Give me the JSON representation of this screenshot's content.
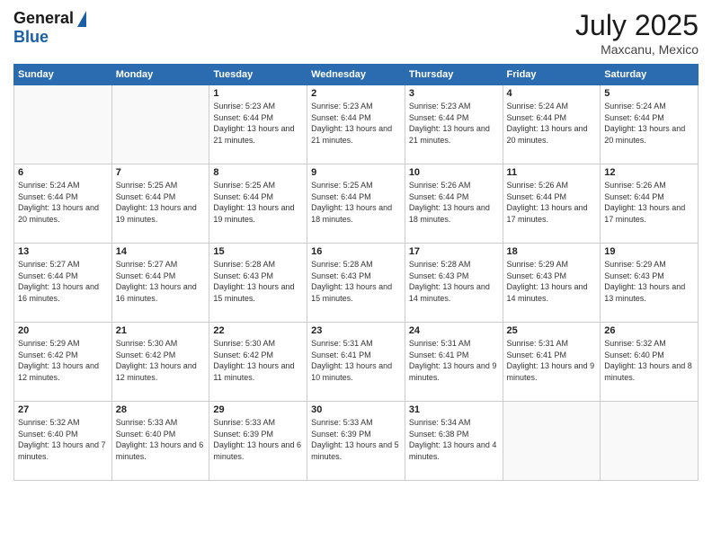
{
  "logo": {
    "general": "General",
    "blue": "Blue"
  },
  "header": {
    "month_year": "July 2025",
    "location": "Maxcanu, Mexico"
  },
  "days_of_week": [
    "Sunday",
    "Monday",
    "Tuesday",
    "Wednesday",
    "Thursday",
    "Friday",
    "Saturday"
  ],
  "weeks": [
    [
      {
        "day": "",
        "empty": true
      },
      {
        "day": "",
        "empty": true
      },
      {
        "day": "1",
        "sunrise": "5:23 AM",
        "sunset": "6:44 PM",
        "daylight": "13 hours and 21 minutes."
      },
      {
        "day": "2",
        "sunrise": "5:23 AM",
        "sunset": "6:44 PM",
        "daylight": "13 hours and 21 minutes."
      },
      {
        "day": "3",
        "sunrise": "5:23 AM",
        "sunset": "6:44 PM",
        "daylight": "13 hours and 21 minutes."
      },
      {
        "day": "4",
        "sunrise": "5:24 AM",
        "sunset": "6:44 PM",
        "daylight": "13 hours and 20 minutes."
      },
      {
        "day": "5",
        "sunrise": "5:24 AM",
        "sunset": "6:44 PM",
        "daylight": "13 hours and 20 minutes."
      }
    ],
    [
      {
        "day": "6",
        "sunrise": "5:24 AM",
        "sunset": "6:44 PM",
        "daylight": "13 hours and 20 minutes."
      },
      {
        "day": "7",
        "sunrise": "5:25 AM",
        "sunset": "6:44 PM",
        "daylight": "13 hours and 19 minutes."
      },
      {
        "day": "8",
        "sunrise": "5:25 AM",
        "sunset": "6:44 PM",
        "daylight": "13 hours and 19 minutes."
      },
      {
        "day": "9",
        "sunrise": "5:25 AM",
        "sunset": "6:44 PM",
        "daylight": "13 hours and 18 minutes."
      },
      {
        "day": "10",
        "sunrise": "5:26 AM",
        "sunset": "6:44 PM",
        "daylight": "13 hours and 18 minutes."
      },
      {
        "day": "11",
        "sunrise": "5:26 AM",
        "sunset": "6:44 PM",
        "daylight": "13 hours and 17 minutes."
      },
      {
        "day": "12",
        "sunrise": "5:26 AM",
        "sunset": "6:44 PM",
        "daylight": "13 hours and 17 minutes."
      }
    ],
    [
      {
        "day": "13",
        "sunrise": "5:27 AM",
        "sunset": "6:44 PM",
        "daylight": "13 hours and 16 minutes."
      },
      {
        "day": "14",
        "sunrise": "5:27 AM",
        "sunset": "6:44 PM",
        "daylight": "13 hours and 16 minutes."
      },
      {
        "day": "15",
        "sunrise": "5:28 AM",
        "sunset": "6:43 PM",
        "daylight": "13 hours and 15 minutes."
      },
      {
        "day": "16",
        "sunrise": "5:28 AM",
        "sunset": "6:43 PM",
        "daylight": "13 hours and 15 minutes."
      },
      {
        "day": "17",
        "sunrise": "5:28 AM",
        "sunset": "6:43 PM",
        "daylight": "13 hours and 14 minutes."
      },
      {
        "day": "18",
        "sunrise": "5:29 AM",
        "sunset": "6:43 PM",
        "daylight": "13 hours and 14 minutes."
      },
      {
        "day": "19",
        "sunrise": "5:29 AM",
        "sunset": "6:43 PM",
        "daylight": "13 hours and 13 minutes."
      }
    ],
    [
      {
        "day": "20",
        "sunrise": "5:29 AM",
        "sunset": "6:42 PM",
        "daylight": "13 hours and 12 minutes."
      },
      {
        "day": "21",
        "sunrise": "5:30 AM",
        "sunset": "6:42 PM",
        "daylight": "13 hours and 12 minutes."
      },
      {
        "day": "22",
        "sunrise": "5:30 AM",
        "sunset": "6:42 PM",
        "daylight": "13 hours and 11 minutes."
      },
      {
        "day": "23",
        "sunrise": "5:31 AM",
        "sunset": "6:41 PM",
        "daylight": "13 hours and 10 minutes."
      },
      {
        "day": "24",
        "sunrise": "5:31 AM",
        "sunset": "6:41 PM",
        "daylight": "13 hours and 9 minutes."
      },
      {
        "day": "25",
        "sunrise": "5:31 AM",
        "sunset": "6:41 PM",
        "daylight": "13 hours and 9 minutes."
      },
      {
        "day": "26",
        "sunrise": "5:32 AM",
        "sunset": "6:40 PM",
        "daylight": "13 hours and 8 minutes."
      }
    ],
    [
      {
        "day": "27",
        "sunrise": "5:32 AM",
        "sunset": "6:40 PM",
        "daylight": "13 hours and 7 minutes."
      },
      {
        "day": "28",
        "sunrise": "5:33 AM",
        "sunset": "6:40 PM",
        "daylight": "13 hours and 6 minutes."
      },
      {
        "day": "29",
        "sunrise": "5:33 AM",
        "sunset": "6:39 PM",
        "daylight": "13 hours and 6 minutes."
      },
      {
        "day": "30",
        "sunrise": "5:33 AM",
        "sunset": "6:39 PM",
        "daylight": "13 hours and 5 minutes."
      },
      {
        "day": "31",
        "sunrise": "5:34 AM",
        "sunset": "6:38 PM",
        "daylight": "13 hours and 4 minutes."
      },
      {
        "day": "",
        "empty": true
      },
      {
        "day": "",
        "empty": true
      }
    ]
  ]
}
